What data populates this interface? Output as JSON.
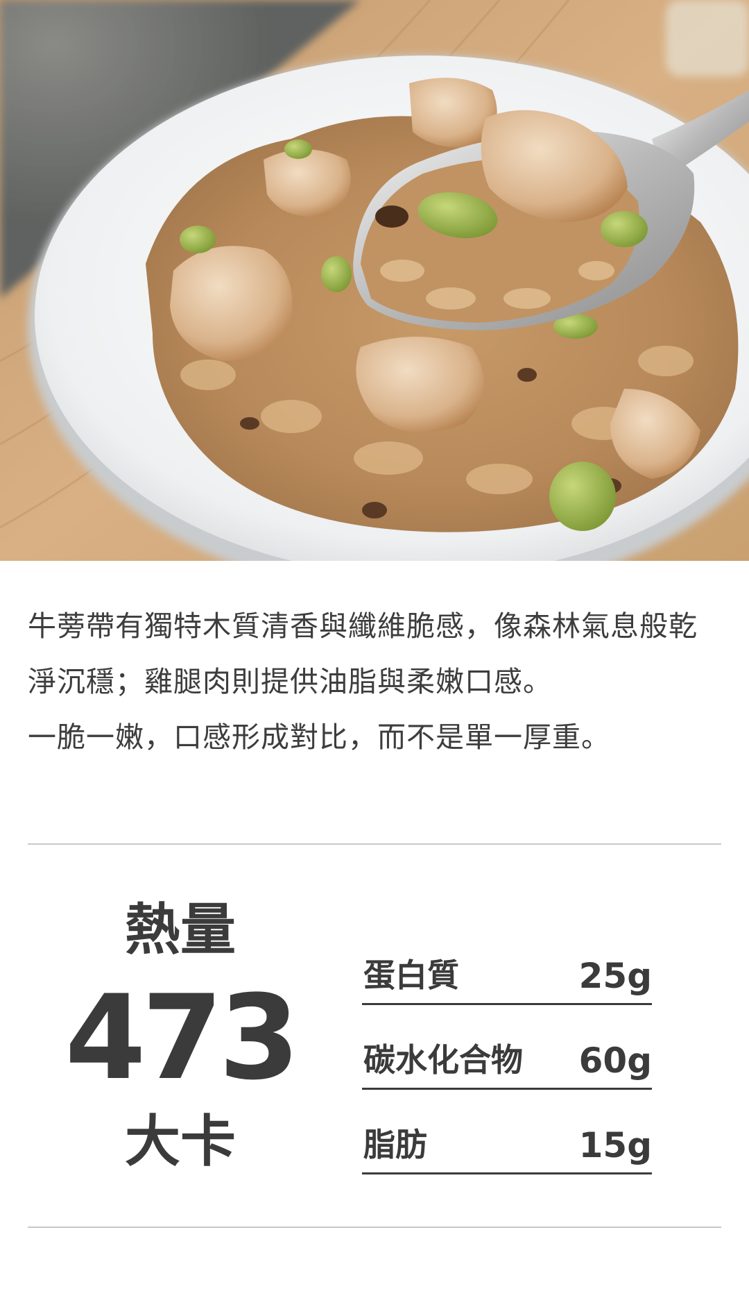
{
  "description": {
    "paragraph_1": "牛蒡帶有獨特木質清香與纖維脆感，像森林氣息般乾淨沉穩；雞腿肉則提供油脂與柔嫩口感。",
    "paragraph_2": "一脆一嫩，口感形成對比，而不是單一厚重。"
  },
  "calories": {
    "label": "熱量",
    "value": "473",
    "unit": "大卡"
  },
  "nutrients": [
    {
      "name": "蛋白質",
      "value": "25g"
    },
    {
      "name": "碳水化合物",
      "value": "60g"
    },
    {
      "name": "脂肪",
      "value": "15g"
    }
  ]
}
